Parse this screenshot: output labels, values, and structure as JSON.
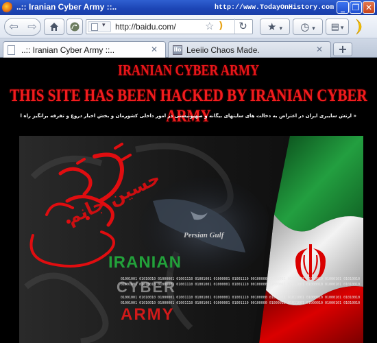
{
  "window": {
    "title": "..:: Iranian Cyber Army ::..",
    "watermark": "http://www.TodayOnHistory.com",
    "minimize_glyph": "_",
    "maximize_glyph": "❐",
    "close_glyph": "✕"
  },
  "toolbar": {
    "back_icon": "arrow-left-icon",
    "forward_icon": "arrow-right-icon",
    "home_icon": "home-icon",
    "evernote_icon": "evernote-elephant-icon",
    "url": "http://baidu.com/",
    "bookmark_icon": "star-icon",
    "rss_icon": "rss-icon",
    "reload_icon": "reload-icon",
    "bookmarks_menu_icon": "star-menu-icon",
    "history_icon": "clock-icon",
    "page_menu_icon": "page-menu-icon",
    "moon_icon": "crescent-moon-icon"
  },
  "tabs": [
    {
      "label": "..:: Iranian Cyber Army ::..",
      "active": true
    },
    {
      "label": "Leeiio Chaos Made.",
      "active": false
    }
  ],
  "new_tab_label": "+",
  "page": {
    "heading_small": "IRANIAN CYBER ARMY",
    "heading_main": "THIS SITE HAS BEEN HACKED BY IRANIAN CYBER ARMY",
    "persian_text": "« ارتش سایبری ایران در اعتراض به دخالت های سایتهای بیگانه و صهیونیستی در امور داخلی کشورمان و بخش اخبار دروغ و تفرقه برانگیز راه اندازی شده است »",
    "banner": {
      "calligraphy": "حسین جانم",
      "map_label": "Persian Gulf",
      "logo_line1": "IRANIAN",
      "logo_line2": "CYBER",
      "logo_line3": "ARMY",
      "binary": "01001001 01010010 01000001 01001110 01001001 01000001 01001110 00100000 01000011 01011001 01000010 01000101 01010010"
    }
  },
  "colors": {
    "headline_red": "#f21c1e",
    "flag_green": "#239f40",
    "flag_red": "#da0000"
  }
}
